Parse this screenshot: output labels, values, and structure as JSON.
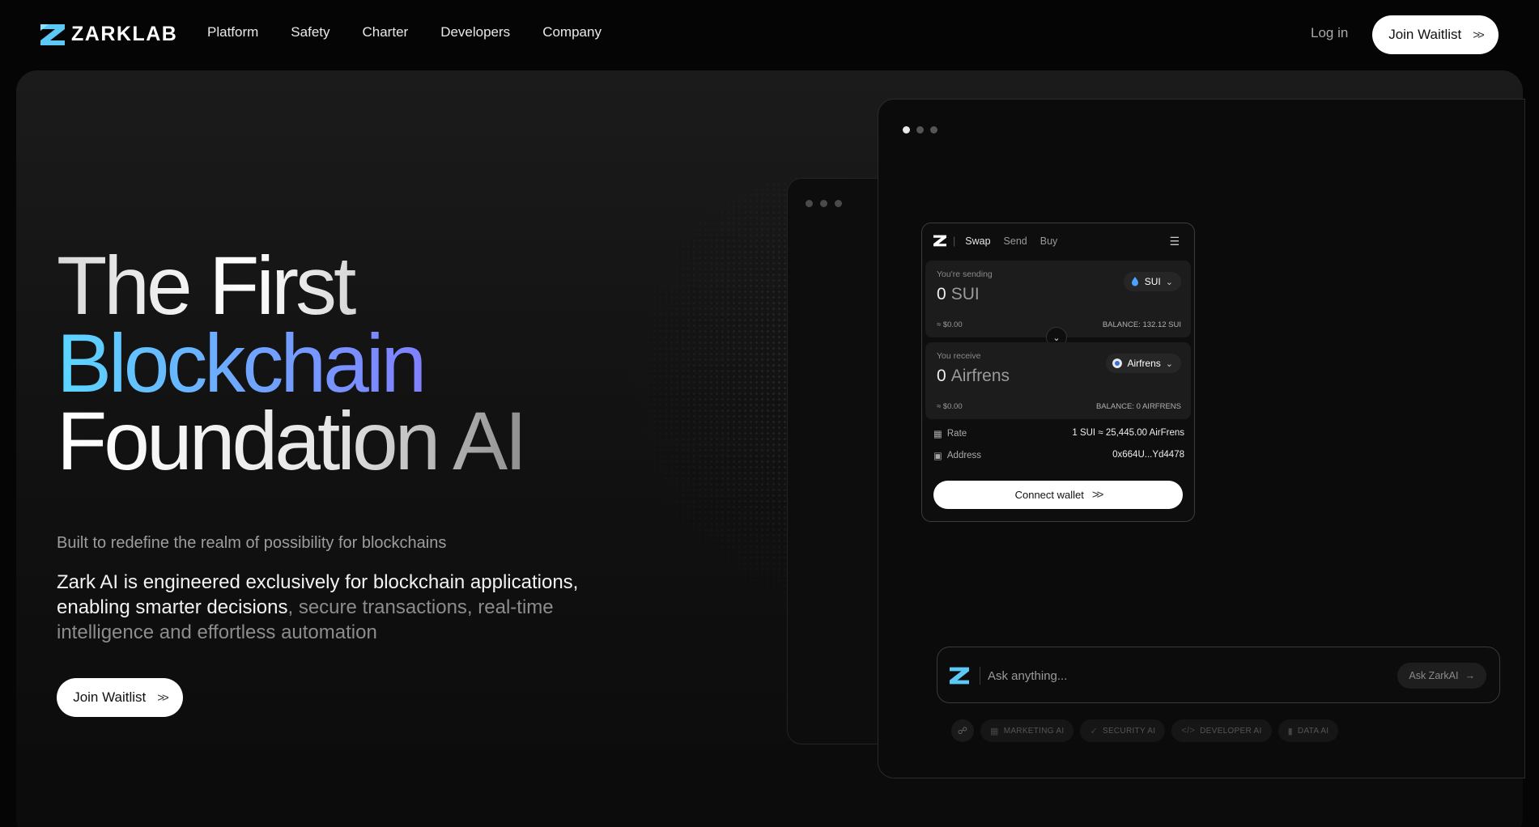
{
  "brand": {
    "name": "ZARKLAB"
  },
  "nav": {
    "links": [
      "Platform",
      "Safety",
      "Charter",
      "Developers",
      "Company"
    ],
    "login": "Log in",
    "join": "Join Waitlist"
  },
  "hero": {
    "line1": "The First",
    "line2": "Blockchain",
    "line3": "Foundation AI",
    "subtitle": "Built to redefine the realm of possibility for blockchains",
    "desc_strong": "Zark AI is engineered exclusively for blockchain applications, enabling smarter decisions",
    "desc_muted": ", secure transactions, real-time intelligence and effortless automation",
    "cta": "Join Waitlist"
  },
  "swap": {
    "tabs": [
      "Swap",
      "Send",
      "Buy"
    ],
    "sending": {
      "label": "You're sending",
      "amount": "0",
      "unit": "SUI",
      "usd": "≈ $0.00",
      "balance": "BALANCE: 132.12 SUI",
      "token": "SUI"
    },
    "receive": {
      "label": "You receive",
      "amount": "0",
      "unit": "Airfrens",
      "usd": "≈ $0.00",
      "balance": "BALANCE: 0 AIRFRENS",
      "token": "Airfrens"
    },
    "rate_label": "Rate",
    "rate_value": "1 SUI ≈ 25,445.00 AirFrens",
    "address_label": "Address",
    "address_value": "0x664U...Yd4478",
    "connect": "Connect wallet"
  },
  "ask": {
    "placeholder": "Ask anything...",
    "button": "Ask ZarkAI",
    "chips": [
      "MARKETING AI",
      "SECURITY AI",
      "DEVELOPER AI",
      "DATA AI"
    ]
  },
  "colors": {
    "accent_blue": "#5ad7ff",
    "accent_purple": "#8b6bff",
    "sui_blue": "#4da2ff"
  }
}
